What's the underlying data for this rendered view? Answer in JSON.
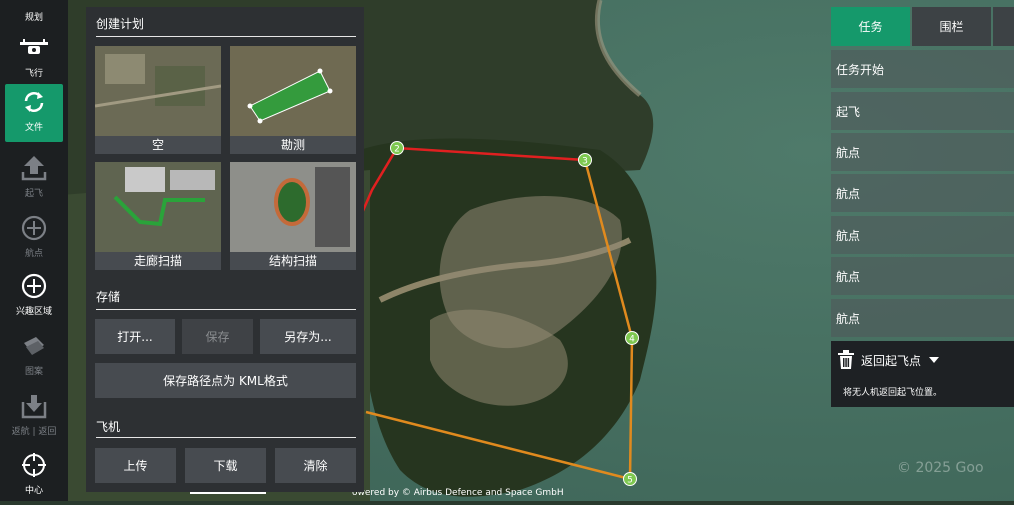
{
  "toolbar": {
    "top_label": "规划",
    "items": [
      {
        "label": "飞行",
        "icon": "drone-icon",
        "active": false,
        "dim": false
      },
      {
        "label": "文件",
        "icon": "sync-icon",
        "active": true,
        "dim": false
      },
      {
        "label": "起飞",
        "icon": "takeoff-icon",
        "active": false,
        "dim": true
      },
      {
        "label": "航点",
        "icon": "plus-circle-icon",
        "active": false,
        "dim": true
      },
      {
        "label": "兴趣区域",
        "icon": "plus-circle-icon",
        "active": false,
        "dim": false
      },
      {
        "label": "图案",
        "icon": "pattern-icon",
        "active": false,
        "dim": true
      },
      {
        "label": "返航 | 返回",
        "icon": "return-icon",
        "active": false,
        "dim": true
      },
      {
        "label": "中心",
        "icon": "crosshair-icon",
        "active": false,
        "dim": false
      }
    ]
  },
  "plan_panel": {
    "create_title": "创建计划",
    "templates": [
      {
        "label": "空"
      },
      {
        "label": "勘测"
      },
      {
        "label": "走廊扫描"
      },
      {
        "label": "结构扫描"
      }
    ],
    "storage_title": "存储",
    "open_label": "打开...",
    "save_label": "保存",
    "save_as_label": "另存为...",
    "save_kml_label": "保存路径点为 KML格式",
    "vehicle_title": "飞机",
    "upload_label": "上传",
    "download_label": "下载",
    "clear_label": "清除"
  },
  "mission": {
    "tabs": [
      {
        "label": "任务",
        "active": true
      },
      {
        "label": "围栏",
        "active": false
      }
    ],
    "items": [
      "任务开始",
      "起飞",
      "航点",
      "航点",
      "航点",
      "航点",
      "航点"
    ],
    "rtl_title": "返回起飞点",
    "rtl_desc": "将无人机返回起飞位置。"
  },
  "map": {
    "waypoints": [
      "2",
      "3",
      "4",
      "5"
    ],
    "attribution": "owered by © Airbus Defence and Space GmbH",
    "watermark": "© 2025 Goo"
  },
  "colors": {
    "accent": "#15996b",
    "segment_red": "#e02020",
    "segment_orange": "#e08a1e",
    "waypoint": "#7ec850"
  }
}
